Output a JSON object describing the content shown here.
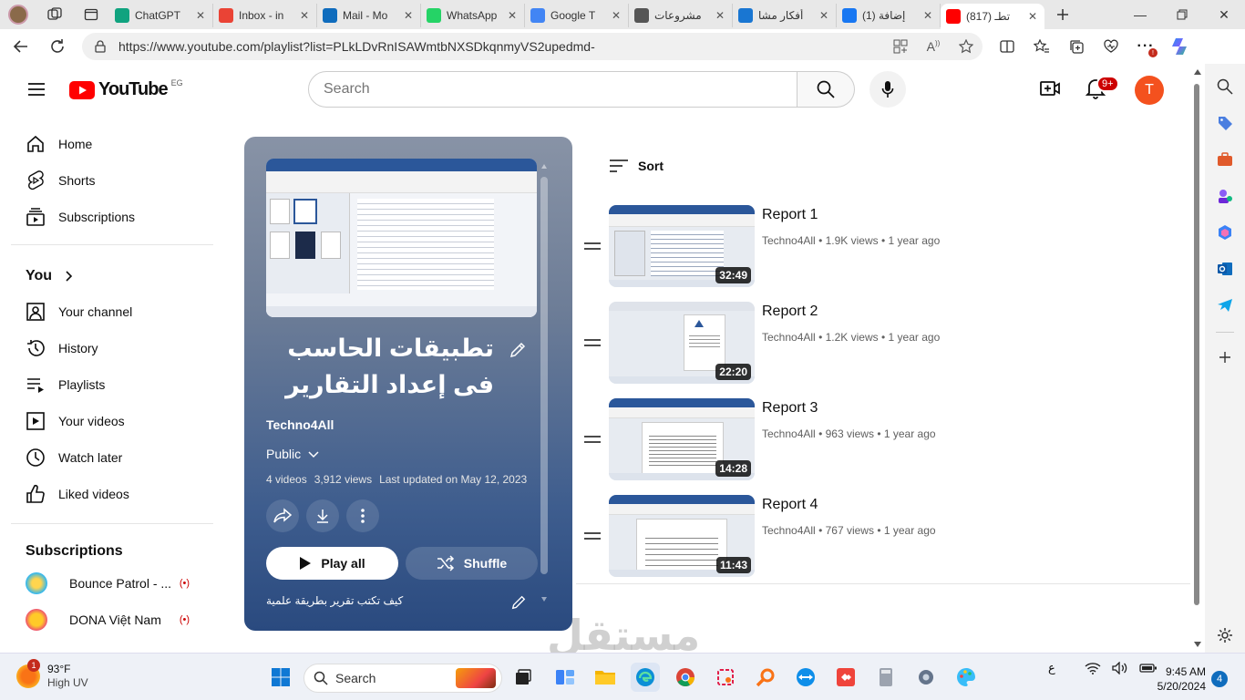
{
  "browser": {
    "tabs": [
      {
        "title": "ChatGPT",
        "color": "#10a37f",
        "active": false
      },
      {
        "title": "Inbox - in",
        "color": "#ea4335",
        "active": false
      },
      {
        "title": "Mail - Mo",
        "color": "#0f6cbd",
        "active": false
      },
      {
        "title": "WhatsApp",
        "color": "#25d366",
        "active": false
      },
      {
        "title": "Google T",
        "color": "#4285f4",
        "active": false
      },
      {
        "title": "مشروعات",
        "color": "#555555",
        "active": false
      },
      {
        "title": "أفكار مشا",
        "color": "#1976d2",
        "active": false
      },
      {
        "title": "(1) إضافة",
        "color": "#1877f2",
        "active": false
      },
      {
        "title": "(817) تطـ",
        "color": "#ff0000",
        "active": true
      }
    ],
    "url": "https://www.youtube.com/playlist?list=PLkLDvRnISAWmtbNXSDkqnmyVS2upedmd-"
  },
  "youtube": {
    "logo_text": "YouTube",
    "country_code": "EG",
    "search_placeholder": "Search",
    "notification_count": "9+",
    "avatar_letter": "T"
  },
  "guide": {
    "main": [
      {
        "label": "Home",
        "icon": "home-icon"
      },
      {
        "label": "Shorts",
        "icon": "shorts-icon"
      },
      {
        "label": "Subscriptions",
        "icon": "subscriptions-icon"
      }
    ],
    "you_heading": "You",
    "you_items": [
      {
        "label": "Your channel",
        "icon": "channel-icon"
      },
      {
        "label": "History",
        "icon": "history-icon"
      },
      {
        "label": "Playlists",
        "icon": "playlists-icon"
      },
      {
        "label": "Your videos",
        "icon": "your-videos-icon"
      },
      {
        "label": "Watch later",
        "icon": "watch-later-icon"
      },
      {
        "label": "Liked videos",
        "icon": "liked-icon"
      }
    ],
    "subs_heading": "Subscriptions",
    "subscriptions": [
      {
        "name": "Bounce Patrol - ...",
        "live": "(•)"
      },
      {
        "name": "DONA Việt Nam",
        "live": "(•)"
      }
    ]
  },
  "playlist": {
    "title": "تطبيقات الحاسب فى إعداد التقارير",
    "owner": "Techno4All",
    "privacy": "Public",
    "video_count": "4 videos",
    "views": "3,912 views",
    "updated": "Last updated on May 12, 2023",
    "play_all": "Play all",
    "shuffle": "Shuffle",
    "description": "كيف تكتب تقرير بطريقة علمية"
  },
  "sort_label": "Sort",
  "videos": [
    {
      "title": "Report 1",
      "channel": "Techno4All",
      "views": "1.9K views",
      "age": "1 year ago",
      "duration": "32:49"
    },
    {
      "title": "Report 2",
      "channel": "Techno4All",
      "views": "1.2K views",
      "age": "1 year ago",
      "duration": "22:20"
    },
    {
      "title": "Report 3",
      "channel": "Techno4All",
      "views": "963 views",
      "age": "1 year ago",
      "duration": "14:28"
    },
    {
      "title": "Report 4",
      "channel": "Techno4All",
      "views": "767 views",
      "age": "1 year ago",
      "duration": "11:43"
    }
  ],
  "meta_sep": "•",
  "watermark": "مستقل",
  "taskbar": {
    "weather_temp": "93°F",
    "weather_desc": "High UV",
    "weather_badge": "1",
    "search_label": "Search",
    "lang": "ع",
    "time": "9:45 AM",
    "date": "5/20/2024",
    "notification_count": "4"
  }
}
